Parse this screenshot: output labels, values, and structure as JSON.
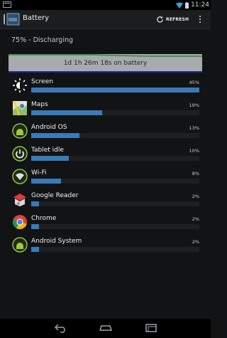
{
  "status_bar": {
    "time": "11:24"
  },
  "action_bar": {
    "title": "Battery",
    "refresh_label": "REFRESH"
  },
  "summary": {
    "status": "75% - Discharging"
  },
  "graph": {
    "label": "1d 1h 26m 18s on battery"
  },
  "colors": {
    "bar": "#3a7ab8",
    "graph_bg": "#a8abad",
    "graph_line": "#2e8b3e"
  },
  "usage": [
    {
      "name": "Screen",
      "percent_label": "45%",
      "value": 45,
      "icon": "screen-brightness-icon"
    },
    {
      "name": "Maps",
      "percent_label": "19%",
      "value": 19,
      "icon": "maps-icon"
    },
    {
      "name": "Android OS",
      "percent_label": "13%",
      "value": 13,
      "icon": "android-os-icon"
    },
    {
      "name": "Tablet idle",
      "percent_label": "10%",
      "value": 10,
      "icon": "power-icon"
    },
    {
      "name": "Wi-Fi",
      "percent_label": "8%",
      "value": 8,
      "icon": "wifi-icon"
    },
    {
      "name": "Google Reader",
      "percent_label": "2%",
      "value": 2,
      "icon": "google-reader-icon"
    },
    {
      "name": "Chrome",
      "percent_label": "2%",
      "value": 2,
      "icon": "chrome-icon"
    },
    {
      "name": "Android System",
      "percent_label": "2%",
      "value": 2,
      "icon": "android-system-icon"
    }
  ]
}
